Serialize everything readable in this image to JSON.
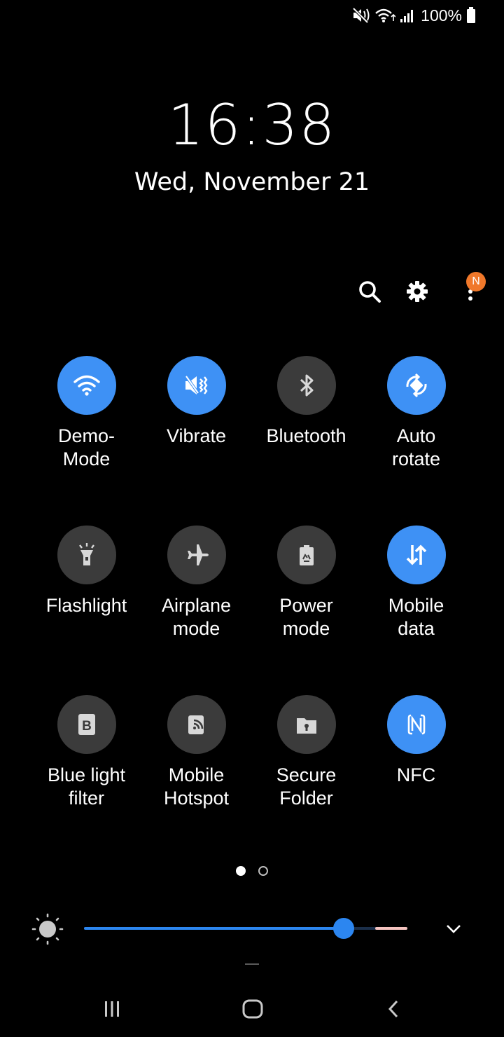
{
  "status_bar": {
    "icons": [
      "mute-vibrate-icon",
      "wifi-icon",
      "signal-icon",
      "battery-icon"
    ],
    "battery_percent": "100%"
  },
  "lock": {
    "time": "16:38",
    "date": "Wed, November 21"
  },
  "header_actions": {
    "icons": [
      "search-icon",
      "gear-icon",
      "more-icon"
    ],
    "more_badge": "N"
  },
  "tiles": [
    {
      "label": "Demo-\nMode",
      "icon": "wifi-icon",
      "state": "on"
    },
    {
      "label": "Vibrate",
      "icon": "vibrate-icon",
      "state": "on"
    },
    {
      "label": "Bluetooth",
      "icon": "bluetooth-icon",
      "state": "off"
    },
    {
      "label": "Auto\nrotate",
      "icon": "auto-rotate-icon",
      "state": "on"
    },
    {
      "label": "Flashlight",
      "icon": "flashlight-icon",
      "state": "off"
    },
    {
      "label": "Airplane\nmode",
      "icon": "airplane-icon",
      "state": "off"
    },
    {
      "label": "Power\nmode",
      "icon": "power-mode-icon",
      "state": "off"
    },
    {
      "label": "Mobile\ndata",
      "icon": "mobile-data-icon",
      "state": "on"
    },
    {
      "label": "Blue light\nfilter",
      "icon": "blue-light-filter-icon",
      "state": "off"
    },
    {
      "label": "Mobile\nHotspot",
      "icon": "hotspot-icon",
      "state": "off"
    },
    {
      "label": "Secure\nFolder",
      "icon": "secure-folder-icon",
      "state": "off"
    },
    {
      "label": "NFC",
      "icon": "nfc-icon",
      "state": "on"
    }
  ],
  "pagination": {
    "current": 1,
    "total": 2
  },
  "brightness": {
    "level": 0.804,
    "extra_level": 0.9
  },
  "colors": {
    "accent": "#3e91f5",
    "tile_off": "#3b3b3b",
    "badge": "#f0782a",
    "background": "#000000"
  },
  "nav_bar": {
    "icons": [
      "recents-icon",
      "home-icon",
      "back-icon"
    ]
  }
}
